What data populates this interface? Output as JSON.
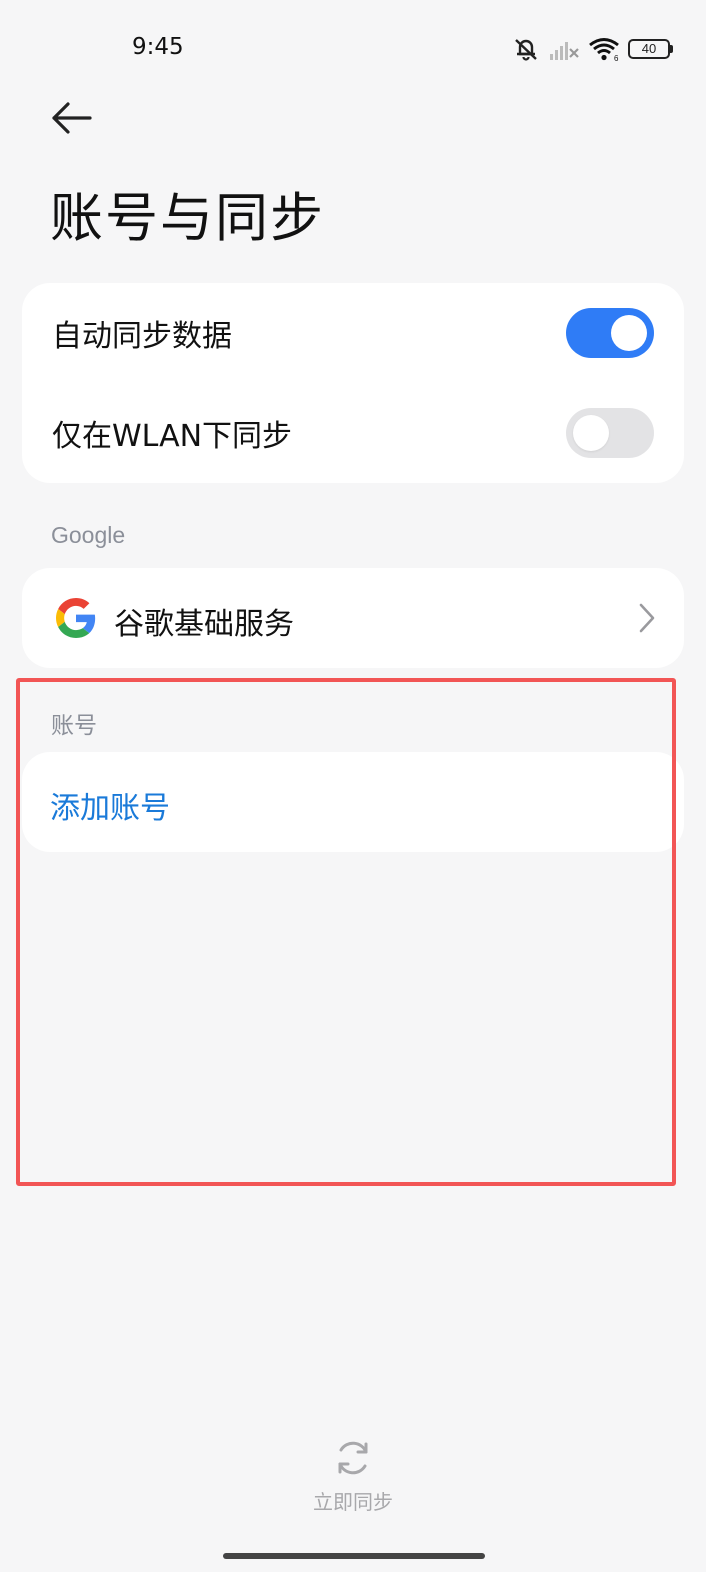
{
  "status_bar": {
    "time": "9:45",
    "battery": "40"
  },
  "header": {
    "title": "账号与同步"
  },
  "sync_settings": {
    "auto_sync": {
      "label": "自动同步数据",
      "enabled": true
    },
    "wlan_only": {
      "label": "仅在WLAN下同步",
      "enabled": false
    }
  },
  "google_section": {
    "header": "Google",
    "item": {
      "label": "谷歌基础服务",
      "icon": "google-g-icon"
    }
  },
  "accounts_section": {
    "header": "账号",
    "add_label": "添加账号"
  },
  "footer": {
    "sync_now_label": "立即同步"
  },
  "colors": {
    "accent": "#2f7cf6",
    "link": "#1a7ad9",
    "highlight": "#f25555",
    "background": "#f6f6f7"
  }
}
